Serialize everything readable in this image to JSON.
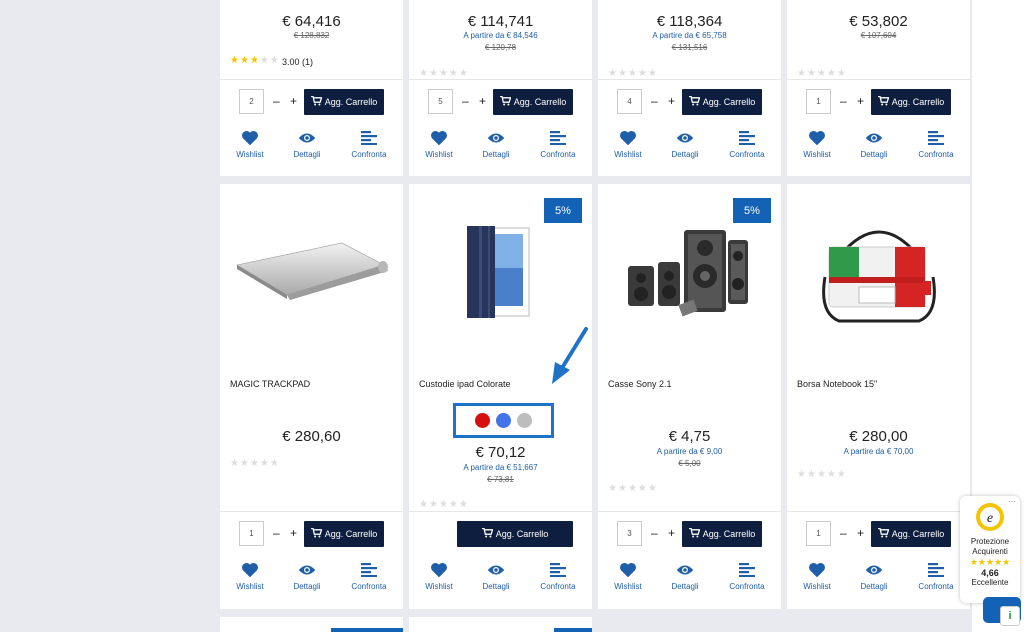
{
  "top_row": [
    {
      "price": "€ 64,416",
      "from": "",
      "old": "€ 128,832",
      "stars_filled": 3,
      "rating": "3.00 (1)",
      "qty": "2"
    },
    {
      "price": "€ 114,741",
      "from": "A partire da € 84,546",
      "old": "€ 120,78",
      "stars_filled": 0,
      "rating": "",
      "qty": "5"
    },
    {
      "price": "€ 118,364",
      "from": "A partire da € 65,758",
      "old": "€ 131,516",
      "stars_filled": 0,
      "rating": "",
      "qty": "4"
    },
    {
      "price": "€ 53,802",
      "from": "",
      "old": "€ 107,604",
      "stars_filled": 0,
      "rating": "",
      "qty": "1"
    }
  ],
  "mid_row": [
    {
      "name": "MAGIC TRACKPAD",
      "price": "€ 280,60",
      "from": "",
      "old": "",
      "badge": "",
      "qty": "1",
      "image": "trackpad"
    },
    {
      "name": "Custodie ipad Colorate",
      "price": "€ 70,12",
      "from": "A partire da € 51,667",
      "old": "€ 73,81",
      "badge": "5%",
      "qty": "",
      "image": "ipad-case"
    },
    {
      "name": "Casse Sony 2.1",
      "price": "€ 4,75",
      "from": "A partire da € 9,00",
      "old": "€ 5,00",
      "badge": "5%",
      "qty": "3",
      "image": "speakers"
    },
    {
      "name": "Borsa Notebook 15\"",
      "price": "€ 280,00",
      "from": "A partire da € 70,00",
      "old": "",
      "badge": "",
      "qty": "1",
      "image": "bag"
    }
  ],
  "swatch_colors": [
    "#d60e0e",
    "#4472e8",
    "#bdbdbd"
  ],
  "labels": {
    "add_to_cart": "Agg. Carrello",
    "wishlist": "Wishlist",
    "details": "Dettagli",
    "compare": "Confronta",
    "minus": "–",
    "plus": "+"
  },
  "trust": {
    "line1": "Protezione",
    "line2": "Acquirenti",
    "stars": "★★★★★",
    "score": "4,66",
    "rating": "Eccellente"
  },
  "colors": {
    "navy": "#0e1e3f",
    "blue": "#1462b5",
    "link": "#1f5ea8"
  }
}
